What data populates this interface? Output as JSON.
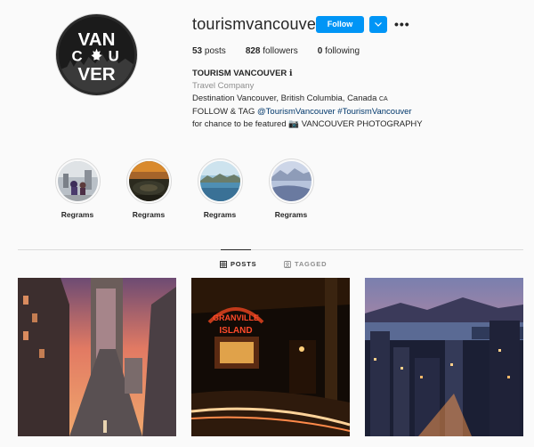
{
  "profile": {
    "username": "tourismvancouver",
    "follow_label": "Follow",
    "avatar_text_top": "VAN",
    "avatar_text_mid": "CU",
    "avatar_text_bot": "VER",
    "stats": {
      "posts_count": "53",
      "posts_label": "posts",
      "followers_count": "828",
      "followers_label": "followers",
      "following_count": "0",
      "following_label": "following"
    },
    "bio": {
      "name": "TOURISM VANCOUVER",
      "name_icon": "ℹ",
      "category": "Travel Company",
      "line1": "Destination Vancouver, British Columbia, Canada",
      "line1_flag": "CA",
      "line2_prefix": "FOLLOW & TAG",
      "line2_handle": "@TourismVancouver",
      "line2_tag": "#TourismVancouver",
      "line3_prefix": "for chance to be featured",
      "line3_icon": "📷",
      "line3_suffix": "VANCOUVER PHOTOGRAPHY"
    }
  },
  "highlights": [
    {
      "label": "Regrams"
    },
    {
      "label": "Regrams"
    },
    {
      "label": "Regrams"
    },
    {
      "label": "Regrams"
    }
  ],
  "tabs": {
    "posts": "POSTS",
    "tagged": "TAGGED"
  },
  "colors": {
    "accent": "#0095f6",
    "link": "#00376b",
    "muted": "#8e8e8e"
  }
}
